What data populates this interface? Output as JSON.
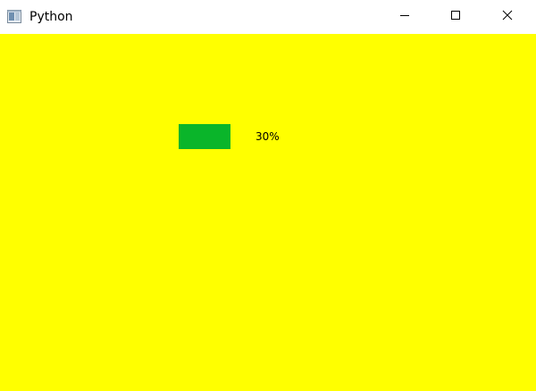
{
  "window": {
    "title": "Python",
    "icon": "python-window-icon",
    "controls": [
      "minimize-icon",
      "maximize-icon",
      "close-icon"
    ]
  },
  "colors": {
    "client_background": "#ffff00",
    "progress_chunk": "#0ab52a"
  },
  "progress": {
    "value": 30,
    "text": "30%"
  }
}
